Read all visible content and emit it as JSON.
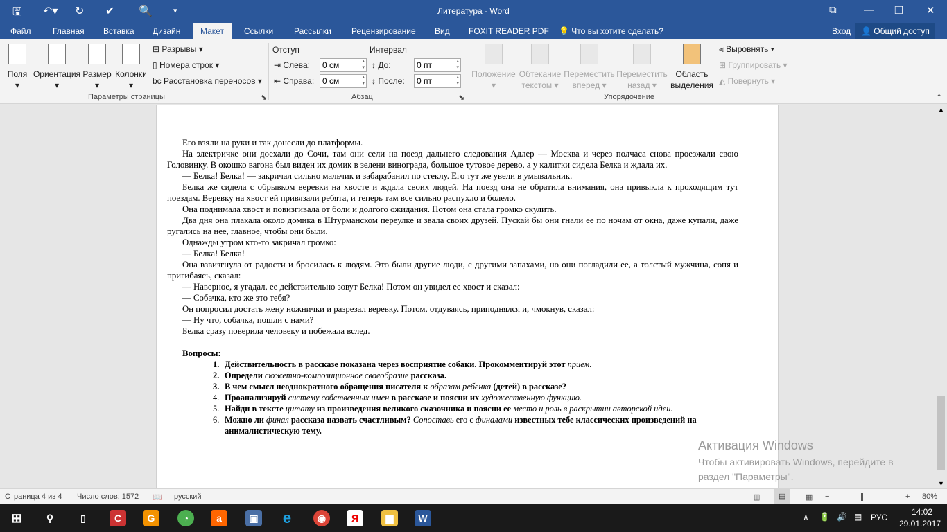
{
  "window": {
    "title": "Литература - Word"
  },
  "tabs": [
    "Файл",
    "Главная",
    "Вставка",
    "Дизайн",
    "Макет",
    "Ссылки",
    "Рассылки",
    "Рецензирование",
    "Вид",
    "FOXIT READER PDF"
  ],
  "tell_me": "Что вы хотите сделать?",
  "signin": "Вход",
  "share": "Общий доступ",
  "ribbon": {
    "page_setup": {
      "fields": "Поля",
      "orientation": "Ориентация",
      "size": "Размер",
      "columns": "Колонки",
      "breaks": "Разрывы",
      "line_numbers": "Номера строк",
      "hyphenation": "Расстановка переносов",
      "group": "Параметры страницы"
    },
    "paragraph": {
      "indent": "Отступ",
      "spacing": "Интервал",
      "left_label": "Слева:",
      "left_value": "0 см",
      "right_label": "Справа:",
      "right_value": "0 см",
      "before_label": "До:",
      "before_value": "0 пт",
      "after_label": "После:",
      "after_value": "0 пт",
      "group": "Абзац"
    },
    "arrange": {
      "position": "Положение",
      "wrap1": "Обтекание",
      "wrap2": "текстом",
      "forward1": "Переместить",
      "forward2": "вперед",
      "backward1": "Переместить",
      "backward2": "назад",
      "selection1": "Область",
      "selection2": "выделения",
      "align": "Выровнять",
      "group_btn": "Группировать",
      "rotate": "Повернуть",
      "group": "Упорядочение"
    }
  },
  "document": {
    "paragraphs": [
      "Его взяли на руки и так донесли до платформы.",
      "На электричке они доехали до Сочи, там они сели на поезд дальнего следования Адлер — Москва и через полчаса снова проезжали свою Головинку. В окошко вагона был виден их домик в зелени винограда, большое тутовое дерево, а у калитки сидела Белка и ждала их.",
      "— Белка! Белка! — закричал сильно мальчик и забарабанил по стеклу. Его тут же увели в умывальник.",
      "Белка же сидела с обрывком веревки на хвосте и ждала своих людей. На поезд она не обратила внимания, она привыкла к проходящим тут поездам. Веревку на хвост ей привязали ребята, и теперь там все сильно распухло и болело.",
      "Она поднимала хвост и повизгивала от боли и долгого ожидания. Потом она стала громко скулить.",
      "Два дня она плакала около домика в Штурманском переулке и звала своих друзей. Пускай бы они гнали ее по ночам от окна, даже купали, даже ругались на нее, главное, чтобы они были.",
      "Однажды утром кто-то закричал громко:",
      "— Белка! Белка!",
      "Она взвизгнула от радости и бросилась к людям. Это были другие люди, с другими запахами, но они погладили ее, а толстый мужчина, сопя и пригибаясь, сказал:",
      "— Наверное, я угадал, ее действительно зовут Белка! Потом он увидел ее хвост и сказал:",
      "— Собачка, кто же это тебя?",
      "Он попросил достать жену ножнички и разрезал веревку. Потом, отдуваясь, приподнялся и, чмокнув, сказал:",
      "— Ну что, собачка, пошли с нами?",
      "Белка сразу поверила человеку и побежала вслед."
    ],
    "questions_heading": "Вопросы:",
    "questions": [
      {
        "n": "1.",
        "nb": true,
        "parts": [
          [
            "b",
            "Действительность в рассказе показана через восприятие собаки. Прокомментируй этот "
          ],
          [
            "i",
            "прием"
          ],
          [
            "b",
            "."
          ]
        ]
      },
      {
        "n": "2.",
        "nb": true,
        "parts": [
          [
            "b",
            "Определи "
          ],
          [
            "i",
            "сюжетно-композиционное своеобразие"
          ],
          [
            "b",
            " рассказа."
          ]
        ]
      },
      {
        "n": "3.",
        "nb": true,
        "parts": [
          [
            "b",
            "В чем смысл неоднократного обращения писателя к "
          ],
          [
            "i",
            "образам ребенка"
          ],
          [
            "b",
            " (детей) в рассказе?"
          ]
        ]
      },
      {
        "n": "4.",
        "nb": false,
        "parts": [
          [
            "b",
            "Проанализируй "
          ],
          [
            "i",
            "систему собственных имен"
          ],
          [
            "b",
            " в рассказе и поясни их "
          ],
          [
            "i",
            "художественную функцию."
          ]
        ]
      },
      {
        "n": "5.",
        "nb": false,
        "parts": [
          [
            "b",
            "Найди в тексте "
          ],
          [
            "i",
            "цитату"
          ],
          [
            "b",
            " из произведения великого сказочника и поясни ее "
          ],
          [
            "i",
            "место и роль в раскрытии авторской идеи."
          ]
        ]
      },
      {
        "n": "6.",
        "nb": false,
        "parts": [
          [
            "b",
            "Можно ли "
          ],
          [
            "i",
            "финал"
          ],
          [
            "b",
            " рассказа назвать счастливым? "
          ],
          [
            "i",
            "Сопоставь"
          ],
          [
            "r",
            " его с "
          ],
          [
            "i",
            "финалами"
          ],
          [
            "b",
            " известных тебе классических произведений на анималистическую тему."
          ]
        ]
      }
    ]
  },
  "activation": {
    "title": "Активация Windows",
    "text": "Чтобы активировать Windows, перейдите в раздел \"Параметры\"."
  },
  "status": {
    "page": "Страница 4 из 4",
    "words": "Число слов: 1572",
    "language": "русский",
    "zoom": "80%",
    "zoom_level": 80
  },
  "taskbar": {
    "language": "РУС",
    "time": "14:02",
    "date": "29.01.2017"
  }
}
